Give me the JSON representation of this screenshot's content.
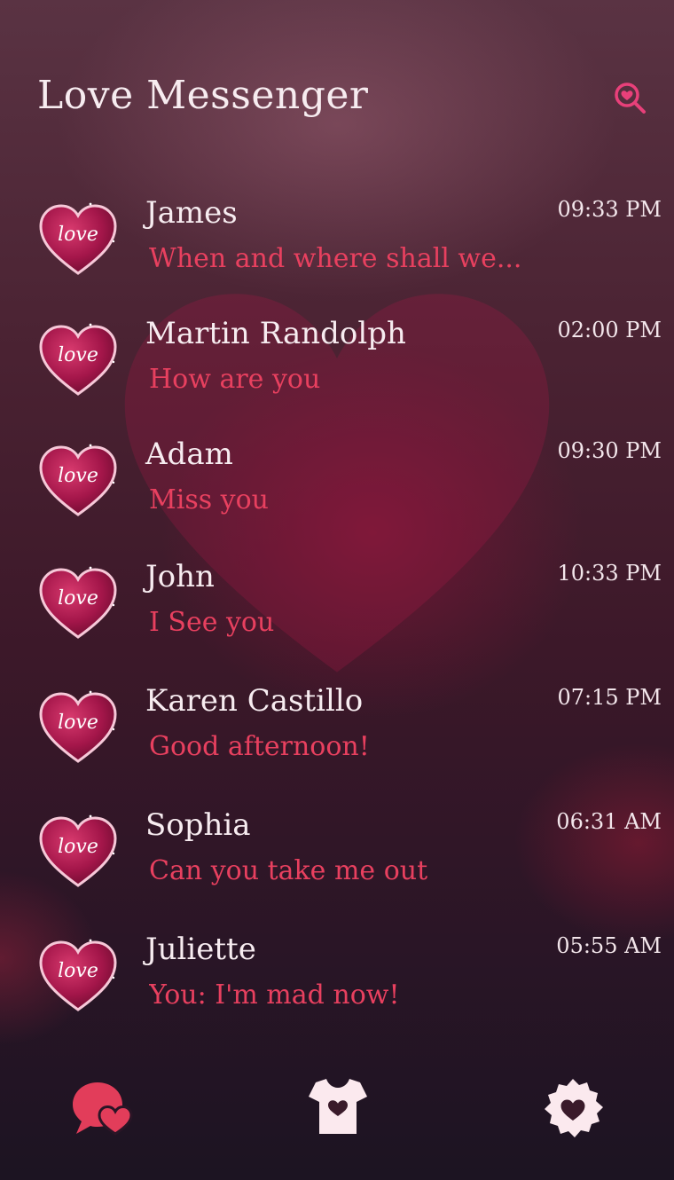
{
  "app": {
    "title": "Love Messenger"
  },
  "header": {
    "search_icon": "heart-search-icon",
    "accent_color": "#e8407a"
  },
  "avatar": {
    "label": "love",
    "icon": "love-heart-icon"
  },
  "conversations": [
    {
      "name": "James",
      "time": "09:33 PM",
      "preview": "When and where shall we..."
    },
    {
      "name": "Martin Randolph",
      "time": "02:00 PM",
      "preview": "How are you"
    },
    {
      "name": "Adam",
      "time": "09:30 PM",
      "preview": "Miss you"
    },
    {
      "name": "John",
      "time": "10:33 PM",
      "preview": "I See you"
    },
    {
      "name": "Karen Castillo",
      "time": "07:15 PM",
      "preview": "Good afternoon!"
    },
    {
      "name": "Sophia",
      "time": "06:31 AM",
      "preview": "Can you take me out"
    },
    {
      "name": "Juliette",
      "time": "05:55 AM",
      "preview": "You: I'm mad now!"
    }
  ],
  "bottom_nav": [
    {
      "name": "chats",
      "icon": "chat-heart-icon"
    },
    {
      "name": "themes",
      "icon": "shirt-heart-icon"
    },
    {
      "name": "settings",
      "icon": "gear-heart-icon"
    }
  ],
  "colors": {
    "name_text": "#f7ecf0",
    "preview_text": "#e8405f",
    "accent": "#e8407a"
  }
}
